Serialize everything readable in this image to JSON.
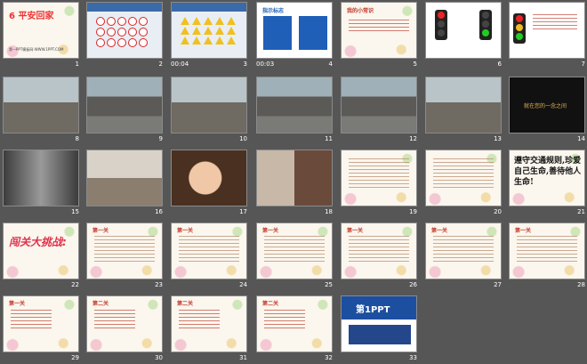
{
  "slides": [
    {
      "number": "1",
      "title": "6 平安回家",
      "caption": "第一PPT模板网-WWW.1PPT.COM"
    },
    {
      "number": "2"
    },
    {
      "number": "3",
      "timing": "00:04"
    },
    {
      "number": "4",
      "timing": "00:03",
      "title": "指示标志"
    },
    {
      "number": "5",
      "title": "我的小常识",
      "text": "看到红灯要停车,在道路上靠右边行走……"
    },
    {
      "number": "6"
    },
    {
      "number": "7",
      "text": "红灯亮,停一停;绿灯亮,往前行;黄灯亮,等一等"
    },
    {
      "number": "8"
    },
    {
      "number": "9"
    },
    {
      "number": "10"
    },
    {
      "number": "11"
    },
    {
      "number": "12"
    },
    {
      "number": "13"
    },
    {
      "number": "14",
      "text": "就在您的一念之间"
    },
    {
      "number": "15"
    },
    {
      "number": "16"
    },
    {
      "number": "17"
    },
    {
      "number": "18"
    },
    {
      "number": "19"
    },
    {
      "number": "20"
    },
    {
      "number": "21",
      "text": "遵守交通规则,珍爱自己生命,善待他人生命!"
    },
    {
      "number": "22",
      "title": "闯关大挑战:"
    },
    {
      "number": "23",
      "title": "第一关"
    },
    {
      "number": "24",
      "title": "第一关"
    },
    {
      "number": "25",
      "title": "第一关"
    },
    {
      "number": "26",
      "title": "第一关"
    },
    {
      "number": "27",
      "title": "第一关"
    },
    {
      "number": "28",
      "title": "第一关"
    },
    {
      "number": "29",
      "title": "第一关"
    },
    {
      "number": "30",
      "title": "第二关"
    },
    {
      "number": "31",
      "title": "第二关"
    },
    {
      "number": "32",
      "title": "第二关"
    },
    {
      "number": "33",
      "title": "第1PPT"
    }
  ]
}
